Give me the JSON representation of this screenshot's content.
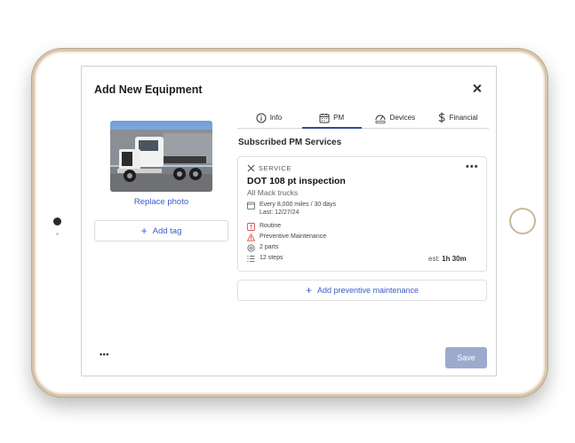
{
  "dialog": {
    "title": "Add New Equipment",
    "close_icon": "close-icon"
  },
  "left": {
    "photo_alt": "truck-photo",
    "replace_photo": "Replace photo",
    "add_tag": "Add tag"
  },
  "tabs": [
    {
      "label": "Info",
      "icon": "info-icon",
      "active": false
    },
    {
      "label": "PM",
      "icon": "calendar-icon",
      "active": true
    },
    {
      "label": "Devices",
      "icon": "gauge-icon",
      "active": false
    },
    {
      "label": "Financial",
      "icon": "dollar-icon",
      "active": false
    }
  ],
  "pm": {
    "section_title": "Subscribed PM Services",
    "card": {
      "category": "SERVICE",
      "name": "DOT 108 pt inspection",
      "scope": "All Mack trucks",
      "interval": "Every 8,000 miles / 30 days",
      "last": "Last: 12/27/24",
      "type": "Routine",
      "kind": "Preventive Maintenance",
      "parts": "2 parts",
      "steps": "12 steps",
      "est_label": "est:",
      "est_value": "1h 30m"
    },
    "add_label": "Add preventive maintenance"
  },
  "footer": {
    "more": "•••",
    "save": "Save"
  },
  "colors": {
    "accent": "#3a5cc7",
    "tab_underline": "#2f4c9c",
    "save_disabled": "#9eaacd",
    "warning": "#d9534f"
  }
}
